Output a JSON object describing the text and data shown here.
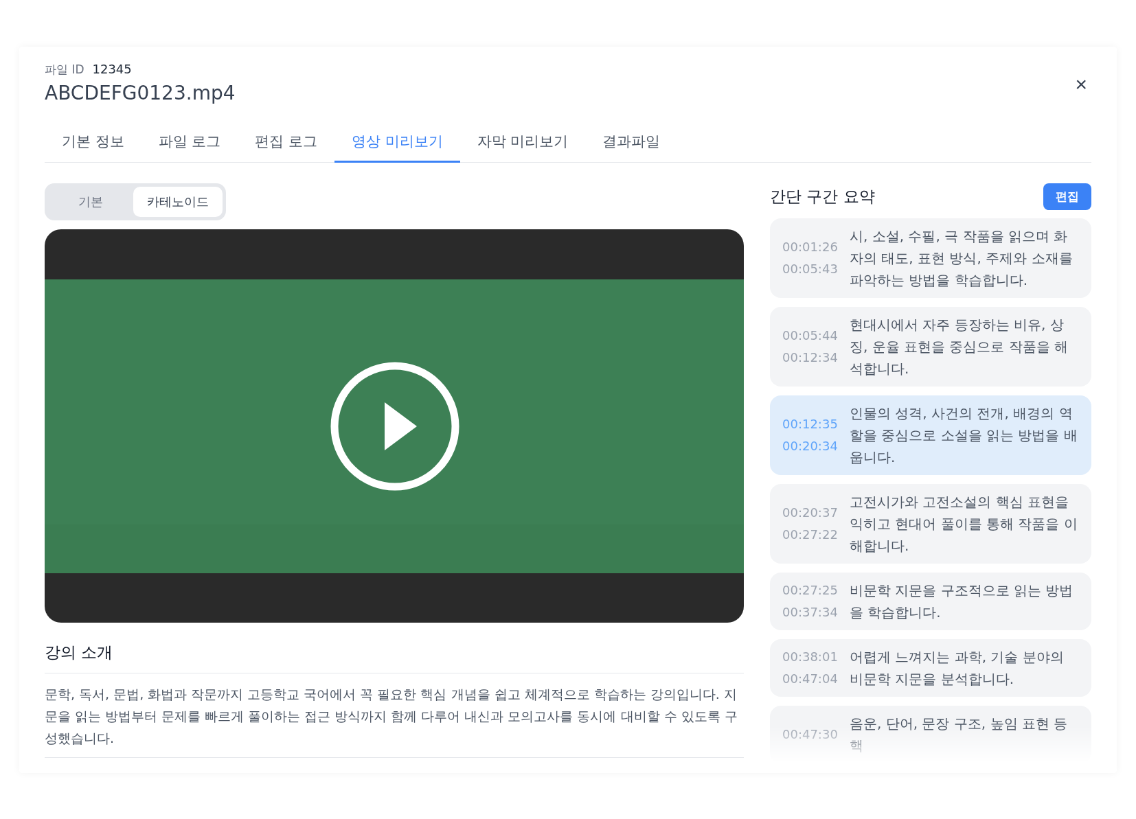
{
  "header": {
    "file_id_label": "파일 ID",
    "file_id": "12345",
    "title": "ABCDEFG0123.mp4",
    "close": "×"
  },
  "tabs": [
    {
      "label": "기본 정보",
      "selected": false
    },
    {
      "label": "파일 로그",
      "selected": false
    },
    {
      "label": "편집 로그",
      "selected": false
    },
    {
      "label": "영상 미리보기",
      "selected": true
    },
    {
      "label": "자막 미리보기",
      "selected": false
    },
    {
      "label": "결과파일",
      "selected": false
    }
  ],
  "view_toggle": [
    {
      "label": "기본",
      "selected": false
    },
    {
      "label": "카테노이드",
      "selected": true
    }
  ],
  "intro": {
    "title": "강의 소개",
    "text": "문학, 독서, 문법, 화법과 작문까지 고등학교 국어에서 꼭 필요한 핵심 개념을 쉽고 체계적으로 학습하는 강의입니다. 지문을 읽는 방법부터 문제를 빠르게 풀이하는 접근 방식까지 함께 다루어 내신과 모의고사를 동시에 대비할 수 있도록 구성했습니다."
  },
  "summary": {
    "title": "간단 구간 요약",
    "edit_button": "편집",
    "segments": [
      {
        "start": "00:01:26",
        "end": "00:05:43",
        "text": "시, 소설, 수필, 극 작품을 읽으며 화자의 태도, 표현 방식, 주제와 소재를 파악하는 방법을 학습합니다.",
        "selected": false
      },
      {
        "start": "00:05:44",
        "end": "00:12:34",
        "text": "현대시에서 자주 등장하는 비유, 상징, 운율 표현을 중심으로 작품을 해석합니다.",
        "selected": false
      },
      {
        "start": "00:12:35",
        "end": "00:20:34",
        "text": "인물의 성격, 사건의 전개, 배경의 역할을 중심으로 소설을 읽는 방법을 배웁니다.",
        "selected": true
      },
      {
        "start": "00:20:37",
        "end": "00:27:22",
        "text": "고전시가와 고전소설의 핵심 표현을 익히고 현대어 풀이를 통해 작품을 이해합니다.",
        "selected": false
      },
      {
        "start": "00:27:25",
        "end": "00:37:34",
        "text": "비문학 지문을 구조적으로 읽는 방법을 학습합니다.",
        "selected": false
      },
      {
        "start": "00:38:01",
        "end": "00:47:04",
        "text": "어렵게 느껴지는 과학, 기술 분야의 비문학 지문을 분석합니다.",
        "selected": false
      },
      {
        "start": "00:47:30",
        "text": "음운, 단어, 문장 구조, 높임 표현 등 핵",
        "selected": false
      }
    ]
  }
}
